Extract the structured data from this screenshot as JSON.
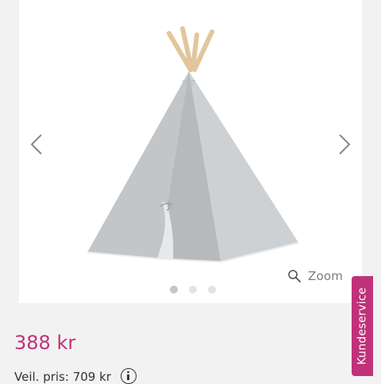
{
  "gallery": {
    "image": "teepee-tent-icon",
    "zoom_label": "Zoom",
    "zoom_icon": "magnifier-icon",
    "prev_icon": "chevron-left-icon",
    "next_icon": "chevron-right-icon",
    "dots": [
      {
        "state": "active"
      },
      {
        "state": "inactive"
      },
      {
        "state": "inactive"
      }
    ]
  },
  "product": {
    "price": "388 kr",
    "rrp": "Veil. pris: 709 kr",
    "info_icon": "info-icon"
  },
  "support": {
    "label": "Kundeservice"
  },
  "colors": {
    "accent": "#c0317a",
    "tent": "#c2c6c9"
  }
}
